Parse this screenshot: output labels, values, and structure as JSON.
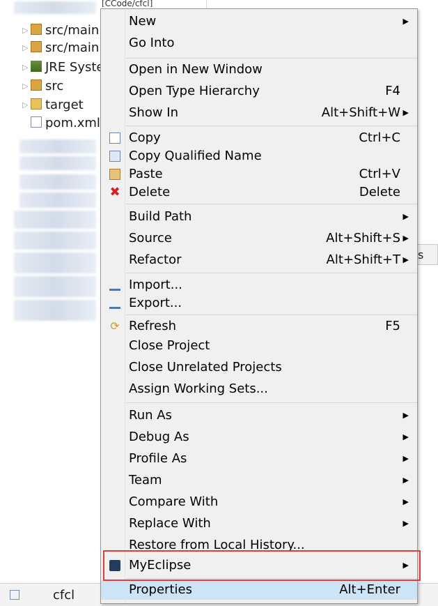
{
  "explorer": {
    "top_text": "[CCode/cfcl]",
    "rows": [
      {
        "label": "src/main",
        "icon": "package-folder-icon"
      },
      {
        "label": "src/main",
        "icon": "package-folder-icon"
      },
      {
        "label": "JRE Syste",
        "icon": "library-icon"
      },
      {
        "label": "src",
        "icon": "package-folder-icon"
      },
      {
        "label": "target",
        "icon": "folder-icon"
      },
      {
        "label": "pom.xml",
        "icon": "xml-file-icon"
      }
    ],
    "right_tab_label": "s",
    "status_bar_text": "cfcl"
  },
  "menu": {
    "items": [
      {
        "label": "New",
        "submenu": true
      },
      {
        "label": "Go Into"
      },
      {
        "label": "Open in New Window"
      },
      {
        "label": "Open Type Hierarchy",
        "shortcut": "F4"
      },
      {
        "label": "Show In",
        "shortcut": "Alt+Shift+W",
        "submenu": true
      },
      {
        "label": "Copy",
        "shortcut": "Ctrl+C",
        "icon": "copy-icon"
      },
      {
        "label": "Copy Qualified Name",
        "icon": "copy-qualified-name-icon"
      },
      {
        "label": "Paste",
        "shortcut": "Ctrl+V",
        "icon": "paste-icon"
      },
      {
        "label": "Delete",
        "shortcut": "Delete",
        "icon": "delete-icon"
      },
      {
        "label": "Build Path",
        "submenu": true
      },
      {
        "label": "Source",
        "shortcut": "Alt+Shift+S",
        "submenu": true
      },
      {
        "label": "Refactor",
        "shortcut": "Alt+Shift+T",
        "submenu": true
      },
      {
        "label": "Import...",
        "icon": "import-icon"
      },
      {
        "label": "Export...",
        "icon": "export-icon"
      },
      {
        "label": "Refresh",
        "shortcut": "F5",
        "icon": "refresh-icon"
      },
      {
        "label": "Close Project"
      },
      {
        "label": "Close Unrelated Projects"
      },
      {
        "label": "Assign Working Sets..."
      },
      {
        "label": "Run As",
        "submenu": true
      },
      {
        "label": "Debug As",
        "submenu": true
      },
      {
        "label": "Profile As",
        "submenu": true
      },
      {
        "label": "Team",
        "submenu": true
      },
      {
        "label": "Compare With",
        "submenu": true
      },
      {
        "label": "Replace With",
        "submenu": true
      },
      {
        "label": "Restore from Local History..."
      },
      {
        "label": "MyEclipse",
        "submenu": true,
        "icon": "myeclipse-icon",
        "emphasized": true
      },
      {
        "label": "Properties",
        "shortcut": "Alt+Enter",
        "highlighted": true
      }
    ],
    "colors": {
      "menu_background": "#f0f0f0",
      "highlight": "#cde4f7",
      "annotation_box": "#e03c3c"
    }
  }
}
